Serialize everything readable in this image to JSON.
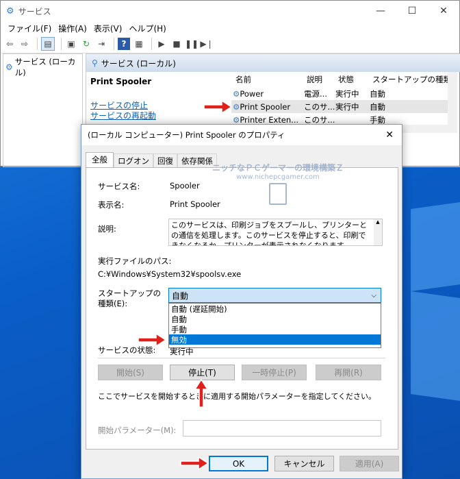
{
  "services_window": {
    "title": "サービス",
    "menu": [
      "ファイル(F)",
      "操作(A)",
      "表示(V)",
      "ヘルプ(H)"
    ],
    "tree_item": "サービス (ローカル)",
    "panel_header": "サービス (ローカル)",
    "selected_service": "Print Spooler",
    "stop_link": "サービスの停止",
    "restart_link": "サービスの再起動",
    "columns": [
      "名前",
      "説明",
      "状態",
      "スタートアップの種類"
    ],
    "rows": [
      {
        "name": "Power",
        "desc": "電源...",
        "status": "実行中",
        "startup": "自動"
      },
      {
        "name": "Print Spooler",
        "desc": "このサ...",
        "status": "実行中",
        "startup": "自動"
      },
      {
        "name": "Printer Exten...",
        "desc": "このサ...",
        "status": "",
        "startup": "手動"
      }
    ]
  },
  "dialog": {
    "title": "(ローカル コンピューター) Print Spooler のプロパティ",
    "tabs": [
      "全般",
      "ログオン",
      "回復",
      "依存関係"
    ],
    "service_name_label": "サービス名:",
    "service_name": "Spooler",
    "display_name_label": "表示名:",
    "display_name": "Print Spooler",
    "description_label": "説明:",
    "description": "このサービスは、印刷ジョブをスプールし、プリンターとの通信を処理します。このサービスを停止すると、印刷できなくなるか、プリンターが表示されなくなります。",
    "path_label": "実行ファイルのパス:",
    "path": "C:¥Windows¥System32¥spoolsv.exe",
    "startup_label": "スタートアップの\n種類(E):",
    "startup_selected": "自動",
    "startup_options": [
      "自動 (遅延開始)",
      "自動",
      "手動",
      "無効"
    ],
    "startup_highlighted": "無効",
    "status_label": "サービスの状態:",
    "status_value": "実行中",
    "buttons": {
      "start": "開始(S)",
      "stop": "停止(T)",
      "pause": "一時停止(P)",
      "resume": "再開(R)"
    },
    "hint": "ここでサービスを開始するときに適用する開始パラメーターを指定してください。",
    "param_label": "開始パラメーター(M):",
    "ok": "OK",
    "cancel": "キャンセル",
    "apply": "適用(A)"
  },
  "watermark": {
    "line1": "ニッチなＰＣゲーマーの環境構築Ｚ",
    "line2": "www.nichepcgamer.com"
  },
  "colors": {
    "accent": "#0078d7",
    "link": "#0b61b7",
    "arrow": "#e0201b",
    "highlight": "#0078d7"
  }
}
